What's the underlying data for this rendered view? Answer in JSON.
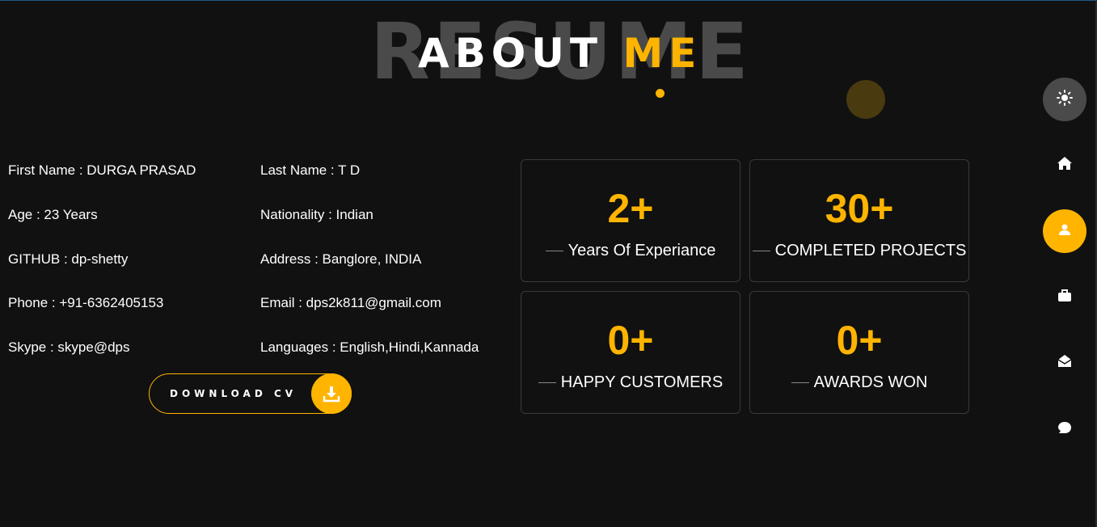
{
  "heading": {
    "background_word": "RESUME",
    "title_main": "ABOUT ",
    "title_accent": "ME"
  },
  "personal_info": {
    "first_name": "First Name : DURGA PRASAD",
    "last_name": "Last Name : T D",
    "age": "Age : 23 Years",
    "nationality": "Nationality : Indian",
    "github": "GITHUB : dp-shetty",
    "address": "Address : Banglore, INDIA",
    "phone": "Phone : +91-6362405153",
    "email": "Email : dps2k811@gmail.com",
    "skype": "Skype : skype@dps",
    "languages": "Languages : English,Hindi,Kannada"
  },
  "download_button": {
    "label": "DOWNLOAD CV",
    "icon": "download-icon"
  },
  "stats": [
    {
      "value": "2+",
      "label": "Years Of Experiance"
    },
    {
      "value": "30+",
      "label": "COMPLETED PROJECTS"
    },
    {
      "value": "0+",
      "label": "HAPPY CUSTOMERS"
    },
    {
      "value": "0+",
      "label": "AWARDS WON"
    }
  ],
  "sidebar_nav": [
    {
      "icon": "sun-icon",
      "purpose": "theme toggle"
    },
    {
      "icon": "home-icon"
    },
    {
      "icon": "user-icon",
      "active": true
    },
    {
      "icon": "briefcase-icon"
    },
    {
      "icon": "envelope-open-icon"
    },
    {
      "icon": "comment-icon"
    }
  ],
  "colors": {
    "background": "#111111",
    "accent": "#ffb400",
    "muted_text": "#4a4a4a",
    "card_border": "#3a3a3a"
  }
}
